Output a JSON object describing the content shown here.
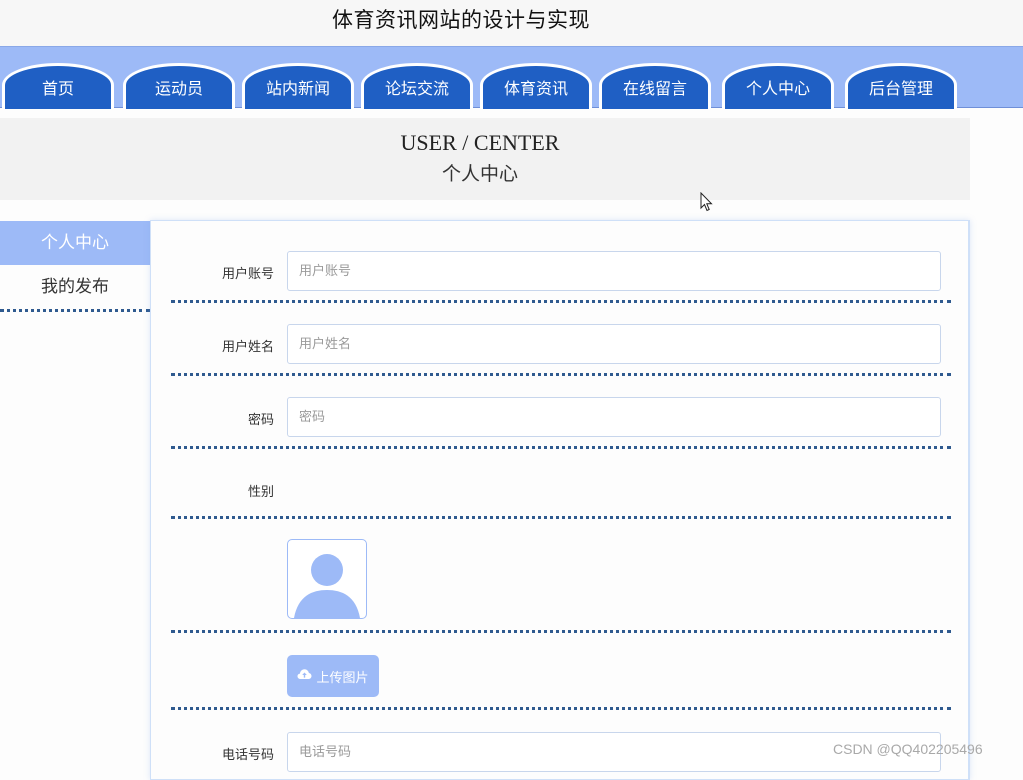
{
  "header": {
    "title": "体育资讯网站的设计与实现"
  },
  "nav": {
    "items": [
      {
        "label": "首页"
      },
      {
        "label": "运动员"
      },
      {
        "label": "站内新闻"
      },
      {
        "label": "论坛交流"
      },
      {
        "label": "体育资讯"
      },
      {
        "label": "在线留言"
      },
      {
        "label": "个人中心"
      },
      {
        "label": "后台管理"
      }
    ]
  },
  "banner": {
    "title_en": "USER / CENTER",
    "title_cn": "个人中心"
  },
  "sidebar": {
    "items": [
      {
        "label": "个人中心",
        "active": true
      },
      {
        "label": "我的发布",
        "active": false
      }
    ]
  },
  "form": {
    "account": {
      "label": "用户账号",
      "placeholder": "用户账号",
      "value": ""
    },
    "name": {
      "label": "用户姓名",
      "placeholder": "用户姓名",
      "value": ""
    },
    "password": {
      "label": "密码",
      "placeholder": "密码",
      "value": ""
    },
    "gender": {
      "label": "性别"
    },
    "avatar": {
      "icon": "user-avatar-placeholder-icon"
    },
    "upload": {
      "label": "上传图片",
      "icon": "cloud-upload-icon"
    },
    "phone": {
      "label": "电话号码",
      "placeholder": "电话号码",
      "value": ""
    }
  },
  "watermark": {
    "text": "CSDN @QQ402205496"
  },
  "colors": {
    "nav_bar": "#9dbaf7",
    "nav_tab": "#1f5fc4",
    "accent_light": "#9dbaf7",
    "divider": "#2f5a8f"
  }
}
